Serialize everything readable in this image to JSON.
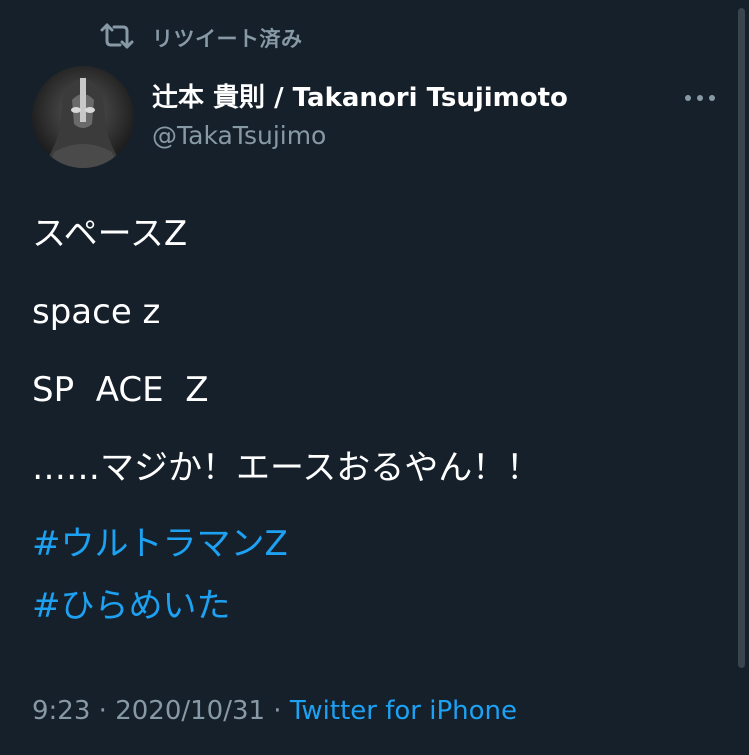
{
  "retweet": {
    "label": "リツイート済み",
    "icon": "retweet-icon"
  },
  "author": {
    "display_name": "辻本 貴則 / Takanori Tsujimoto",
    "handle": "@TakaTsujimo",
    "avatar": "avatar"
  },
  "more_icon": "more-horizontal-icon",
  "tweet": {
    "lines": [
      "スペースZ",
      "space z",
      "SP  ACE  Z",
      "……マジか！エースおるやん！！"
    ],
    "hashtags": [
      "#ウルトラマンZ",
      "#ひらめいた"
    ]
  },
  "meta": {
    "time": "9:23",
    "date": "2020/10/31",
    "separator": " · ",
    "source": "Twitter for iPhone"
  },
  "colors": {
    "background": "#15202b",
    "text": "#ffffff",
    "secondary": "#8899a6",
    "link": "#1da1f2"
  }
}
